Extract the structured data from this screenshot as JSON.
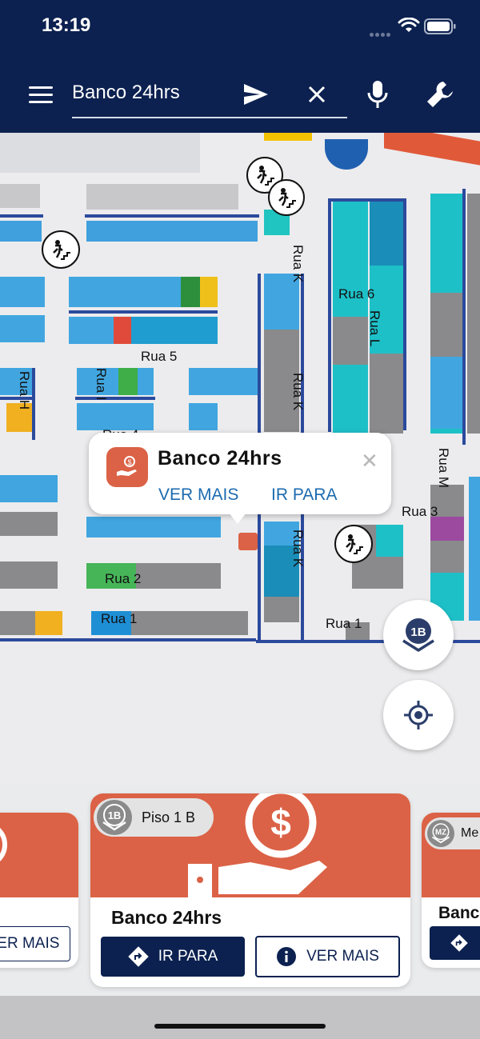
{
  "status": {
    "time": "13:19"
  },
  "search": {
    "value": "Banco 24hrs"
  },
  "map": {
    "streets": [
      "Rua K",
      "Rua 6",
      "Rua L",
      "Rua 5",
      "Rua H",
      "Rua I",
      "Rua 4",
      "Rua K",
      "Rua M",
      "Rua 3",
      "Rua K",
      "Rua 2",
      "Rua 1",
      "Rua 1"
    ]
  },
  "popup": {
    "title": "Banco 24hrs",
    "see_more": "VER MAIS",
    "go_to": "IR PARA"
  },
  "fab": {
    "floor_badge": "1B"
  },
  "cards": {
    "left": {
      "see_more": "VER MAIS"
    },
    "main": {
      "floor_badge": "1B",
      "floor": "Piso 1 B",
      "title": "Banco 24hrs",
      "go_to": "IR PARA",
      "see_more": "VER MAIS"
    },
    "right": {
      "floor_badge": "MZ",
      "floor": "Me",
      "title": "Banc"
    }
  },
  "colors": {
    "navy": "#0c2150",
    "coral": "#db6246",
    "link": "#1c6bb0"
  }
}
